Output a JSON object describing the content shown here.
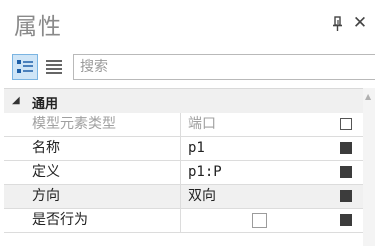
{
  "window": {
    "title": "属性",
    "pin_icon": "pin-icon",
    "close_icon": "close-icon",
    "close_glyph": "✕"
  },
  "toolbar": {
    "categorized_icon": "categorized-view-icon",
    "alphabetical_icon": "list-view-icon",
    "search_placeholder": "搜索"
  },
  "grid": {
    "category": {
      "label": "通用",
      "expanded_glyph": "◢"
    },
    "rows": [
      {
        "name": "模型元素类型",
        "value": "端口",
        "readonly": true,
        "marker": "empty"
      },
      {
        "name": "名称",
        "value": "p1",
        "readonly": false,
        "marker": "filled"
      },
      {
        "name": "定义",
        "value": "p1:P",
        "readonly": false,
        "marker": "filled"
      },
      {
        "name": "方向",
        "value": "双向",
        "readonly": false,
        "marker": "filled",
        "selected": true
      },
      {
        "name": "是否行为",
        "value": "",
        "checkbox": false,
        "readonly": false,
        "marker": "filled"
      }
    ]
  },
  "scrollbar": {
    "up_glyph": "▲"
  }
}
